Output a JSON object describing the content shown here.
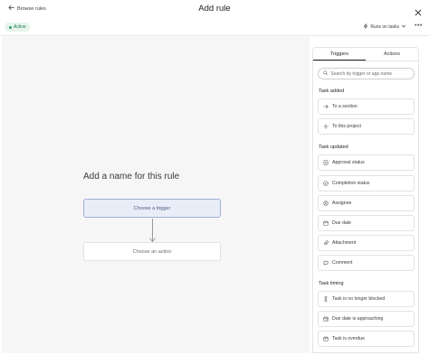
{
  "header": {
    "back_label": "Browse rules",
    "title": "Add rule"
  },
  "subbar": {
    "status": "Active",
    "runs_on": "Runs on tasks",
    "more": "•••"
  },
  "canvas": {
    "rule_name_placeholder": "Add a name for this rule",
    "trigger_label": "Choose a trigger",
    "action_label": "Choose an action"
  },
  "panel": {
    "tabs": [
      "Triggers",
      "Actions"
    ],
    "active_tab": "Triggers",
    "search_placeholder": "Search by trigger or app name",
    "sections": [
      {
        "label": "Task added",
        "items": [
          {
            "label": "To a section",
            "icon": "arrow-right-icon"
          },
          {
            "label": "To this project",
            "icon": "plus-icon"
          }
        ]
      },
      {
        "label": "Task updated",
        "items": [
          {
            "label": "Approval status",
            "icon": "approval-icon"
          },
          {
            "label": "Completion status",
            "icon": "check-circle-icon"
          },
          {
            "label": "Assignee",
            "icon": "user-icon"
          },
          {
            "label": "Due date",
            "icon": "calendar-icon"
          },
          {
            "label": "Attachment",
            "icon": "paperclip-icon"
          },
          {
            "label": "Comment",
            "icon": "comment-icon"
          }
        ]
      },
      {
        "label": "Task timing",
        "items": [
          {
            "label": "Task is no longer blocked",
            "icon": "hourglass-icon"
          },
          {
            "label": "Due date is approaching",
            "icon": "calendar-clock-icon"
          },
          {
            "label": "Task is overdue",
            "icon": "calendar-alert-icon"
          }
        ]
      }
    ]
  },
  "colors": {
    "accent_border": "#9fb0d6",
    "accent_fill": "#e9edf7",
    "active_badge": "#e6f4ec",
    "active_text": "#1b7a4a"
  }
}
